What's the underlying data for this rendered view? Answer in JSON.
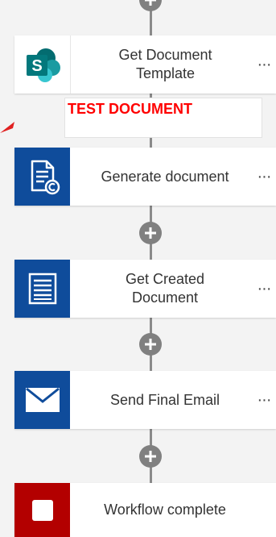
{
  "annotation": {
    "text": "TEST DOCUMENT"
  },
  "steps": [
    {
      "label": "Get Document\nTemplate",
      "icon": "sharepoint-icon",
      "icon_bg": "#ffffff"
    },
    {
      "label": "Generate document",
      "icon": "document-generate-icon",
      "icon_bg": "#0f4c9b"
    },
    {
      "label": "Get Created\nDocument",
      "icon": "document-lines-icon",
      "icon_bg": "#0f4c9b"
    },
    {
      "label": "Send Final Email",
      "icon": "email-icon",
      "icon_bg": "#0f4c9b"
    },
    {
      "label": "Workflow complete",
      "icon": "stop-icon",
      "icon_bg": "#b30000"
    }
  ],
  "more_glyph": "···",
  "colors": {
    "background": "#f3f3f3",
    "connector": "#8a8a8a",
    "annotation_red": "#ff0000",
    "sharepoint_teal": "#036c70"
  }
}
